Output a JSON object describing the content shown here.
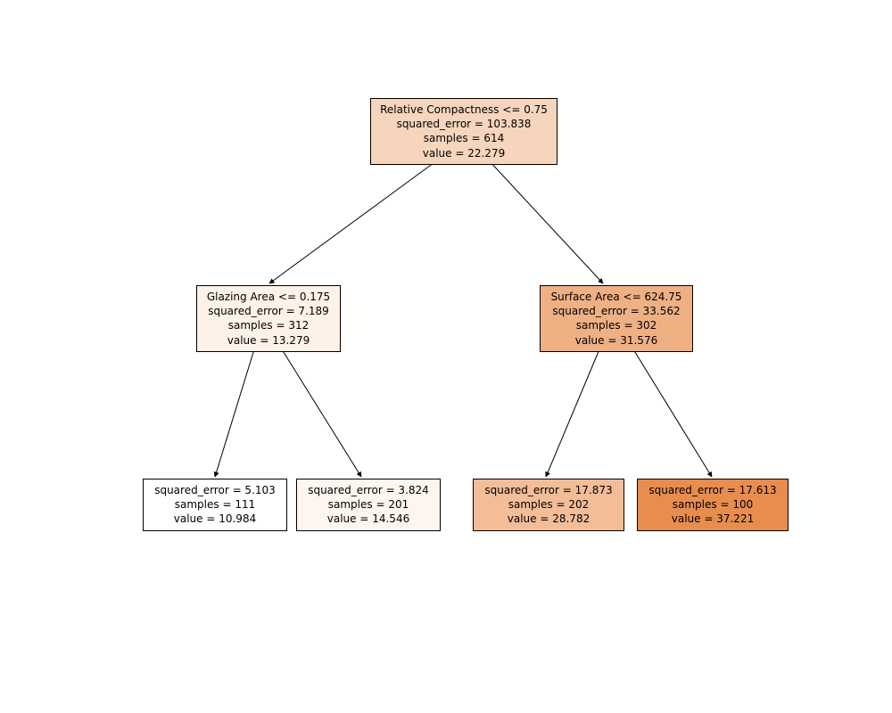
{
  "chart_data": {
    "type": "tree",
    "title": "",
    "nodes": [
      {
        "id": "root",
        "condition": "Relative Compactness <= 0.75",
        "squared_error": 103.838,
        "samples": 614,
        "value": 22.279,
        "fill": "#f6d5bc",
        "left": "n_left",
        "right": "n_right"
      },
      {
        "id": "n_left",
        "condition": "Glazing Area <= 0.175",
        "squared_error": 7.189,
        "samples": 312,
        "value": 13.279,
        "fill": "#fdf1e8",
        "left": "leaf_ll",
        "right": "leaf_lr"
      },
      {
        "id": "n_right",
        "condition": "Surface Area <= 624.75",
        "squared_error": 33.562,
        "samples": 302,
        "value": 31.576,
        "fill": "#efb084",
        "left": "leaf_rl",
        "right": "leaf_rr"
      },
      {
        "id": "leaf_ll",
        "condition": null,
        "squared_error": 5.103,
        "samples": 111,
        "value": 10.984,
        "fill": "#ffffff"
      },
      {
        "id": "leaf_lr",
        "condition": null,
        "squared_error": 3.824,
        "samples": 201,
        "value": 14.546,
        "fill": "#fdf5ef"
      },
      {
        "id": "leaf_rl",
        "condition": null,
        "squared_error": 17.873,
        "samples": 202,
        "value": 28.782,
        "fill": "#f2bd97"
      },
      {
        "id": "leaf_rr",
        "condition": null,
        "squared_error": 17.613,
        "samples": 100,
        "value": 37.221,
        "fill": "#e88d4e"
      }
    ]
  },
  "labels": {
    "squared_error_prefix": "squared_error = ",
    "samples_prefix": "samples = ",
    "value_prefix": "value = "
  },
  "nodes": {
    "root": {
      "line1": "Relative Compactness <= 0.75",
      "line2": "squared_error = 103.838",
      "line3": "samples = 614",
      "line4": "value = 22.279"
    },
    "n_left": {
      "line1": "Glazing Area <= 0.175",
      "line2": "squared_error = 7.189",
      "line3": "samples = 312",
      "line4": "value = 13.279"
    },
    "n_right": {
      "line1": "Surface Area <= 624.75",
      "line2": "squared_error = 33.562",
      "line3": "samples = 302",
      "line4": "value = 31.576"
    },
    "leaf_ll": {
      "line1": "squared_error = 5.103",
      "line2": "samples = 111",
      "line3": "value = 10.984"
    },
    "leaf_lr": {
      "line1": "squared_error = 3.824",
      "line2": "samples = 201",
      "line3": "value = 14.546"
    },
    "leaf_rl": {
      "line1": "squared_error = 17.873",
      "line2": "samples = 202",
      "line3": "value = 28.782"
    },
    "leaf_rr": {
      "line1": "squared_error = 17.613",
      "line2": "samples = 100",
      "line3": "value = 37.221"
    }
  },
  "colors": {
    "root": "#f6d5bc",
    "n_left": "#fdf1e8",
    "n_right": "#efb084",
    "leaf_ll": "#ffffff",
    "leaf_lr": "#fdf5ef",
    "leaf_rl": "#f2bd97",
    "leaf_rr": "#e88d4e"
  }
}
